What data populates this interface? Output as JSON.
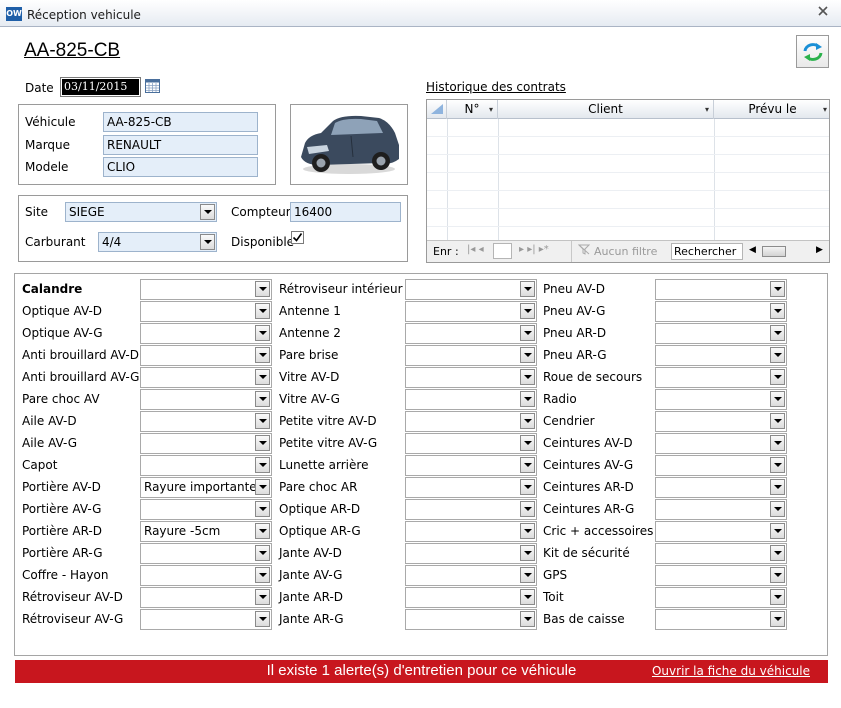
{
  "window": {
    "title": "Réception vehicule",
    "app_icon": "OW"
  },
  "plate": "AA-825-CB",
  "date": {
    "label": "Date",
    "value": "03/11/2015"
  },
  "vehicle": {
    "vehicule_label": "Véhicule",
    "vehicule_value": "AA-825-CB",
    "marque_label": "Marque",
    "marque_value": "RENAULT",
    "modele_label": "Modele",
    "modele_value": "CLIO"
  },
  "site": {
    "site_label": "Site",
    "site_value": "SIEGE",
    "compteur_label": "Compteur",
    "compteur_value": "16400",
    "carburant_label": "Carburant",
    "carburant_value": "4/4",
    "disponible_label": "Disponible",
    "disponible_checked": true
  },
  "history": {
    "title": "Historique des contrats",
    "columns": [
      "N°",
      "Client",
      "Prévu le"
    ],
    "footer": {
      "enr": "Enr :",
      "no_filter": "Aucun filtre",
      "search": "Rechercher"
    }
  },
  "checklist": {
    "col1": [
      {
        "label": "Calandre",
        "value": ""
      },
      {
        "label": "Optique AV-D",
        "value": ""
      },
      {
        "label": "Optique AV-G",
        "value": ""
      },
      {
        "label": "Anti brouillard AV-D",
        "value": ""
      },
      {
        "label": "Anti brouillard AV-G",
        "value": ""
      },
      {
        "label": "Pare choc AV",
        "value": ""
      },
      {
        "label": "Aile AV-D",
        "value": ""
      },
      {
        "label": "Aile AV-G",
        "value": ""
      },
      {
        "label": "Capot",
        "value": ""
      },
      {
        "label": "Portière AV-D",
        "value": "Rayure importante"
      },
      {
        "label": "Portière AV-G",
        "value": ""
      },
      {
        "label": "Portière AR-D",
        "value": "Rayure -5cm"
      },
      {
        "label": "Portière AR-G",
        "value": ""
      },
      {
        "label": "Coffre - Hayon",
        "value": ""
      },
      {
        "label": "Rétroviseur AV-D",
        "value": ""
      },
      {
        "label": "Rétroviseur AV-G",
        "value": ""
      }
    ],
    "col2": [
      {
        "label": "Rétroviseur intérieur",
        "value": ""
      },
      {
        "label": "Antenne 1",
        "value": ""
      },
      {
        "label": "Antenne 2",
        "value": ""
      },
      {
        "label": "Pare brise",
        "value": ""
      },
      {
        "label": "Vitre AV-D",
        "value": ""
      },
      {
        "label": "Vitre AV-G",
        "value": ""
      },
      {
        "label": "Petite vitre AV-D",
        "value": ""
      },
      {
        "label": "Petite vitre AV-G",
        "value": ""
      },
      {
        "label": "Lunette arrière",
        "value": ""
      },
      {
        "label": "Pare choc AR",
        "value": ""
      },
      {
        "label": "Optique AR-D",
        "value": ""
      },
      {
        "label": "Optique AR-G",
        "value": ""
      },
      {
        "label": "Jante AV-D",
        "value": ""
      },
      {
        "label": "Jante AV-G",
        "value": ""
      },
      {
        "label": "Jante AR-D",
        "value": ""
      },
      {
        "label": "Jante AR-G",
        "value": ""
      }
    ],
    "col3": [
      {
        "label": "Pneu AV-D",
        "value": ""
      },
      {
        "label": "Pneu AV-G",
        "value": ""
      },
      {
        "label": "Pneu AR-D",
        "value": ""
      },
      {
        "label": "Pneu AR-G",
        "value": ""
      },
      {
        "label": "Roue de secours",
        "value": ""
      },
      {
        "label": "Radio",
        "value": ""
      },
      {
        "label": "Cendrier",
        "value": ""
      },
      {
        "label": "Ceintures AV-D",
        "value": ""
      },
      {
        "label": "Ceintures AV-G",
        "value": ""
      },
      {
        "label": "Ceintures AR-D",
        "value": ""
      },
      {
        "label": "Ceintures AR-G",
        "value": ""
      },
      {
        "label": "Cric + accessoires",
        "value": ""
      },
      {
        "label": "Kit de sécurité",
        "value": ""
      },
      {
        "label": "GPS",
        "value": ""
      },
      {
        "label": "Toit",
        "value": ""
      },
      {
        "label": "Bas de caisse",
        "value": ""
      }
    ]
  },
  "alert": {
    "text": "Il existe 1 alerte(s) d'entretien pour ce véhicule",
    "link": "Ouvrir la fiche du véhicule",
    "color": "#c8161e"
  },
  "colors": {
    "field_bg": "#e4eef9",
    "field_border": "#9db3cc"
  }
}
